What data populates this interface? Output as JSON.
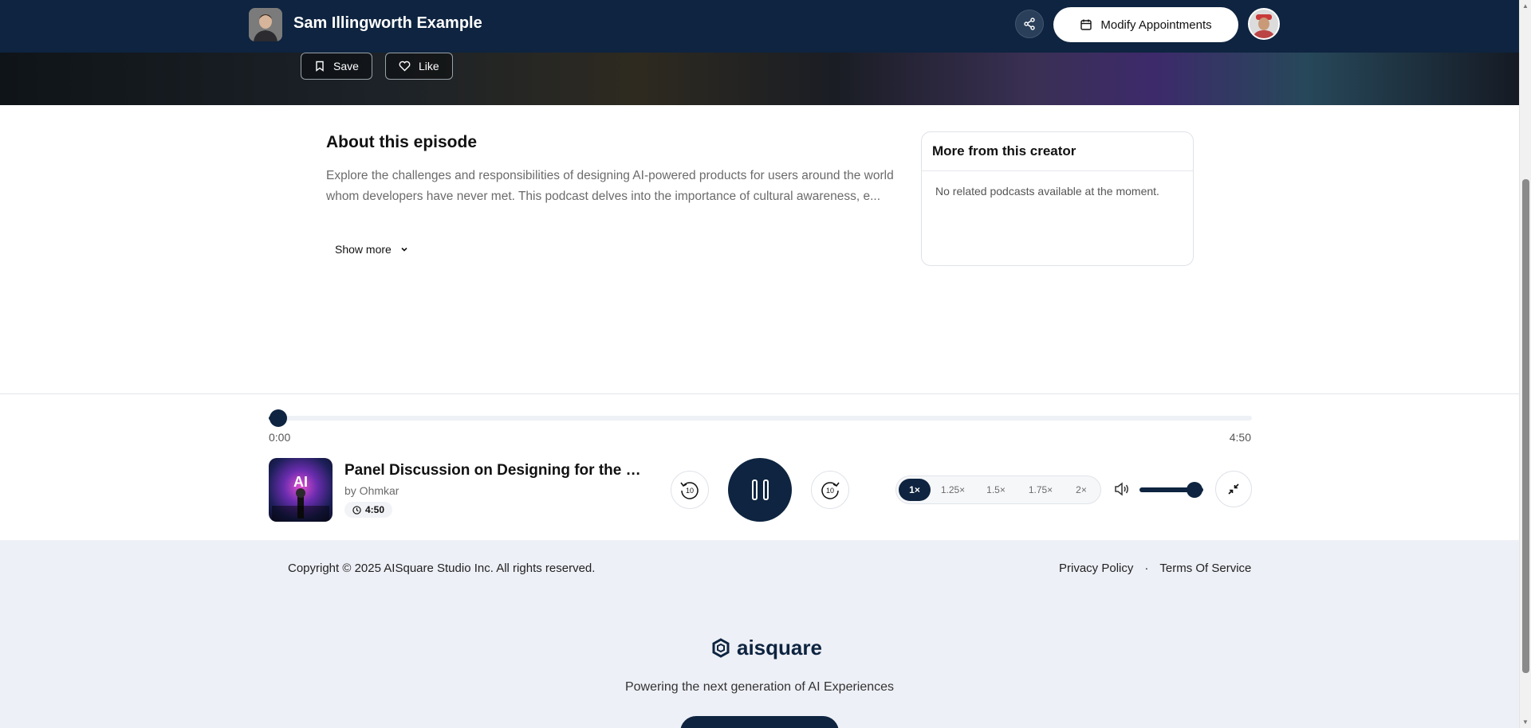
{
  "header": {
    "creator_name": "Sam Illingworth Example",
    "modify_label": "Modify Appointments"
  },
  "hero": {
    "save_label": "Save",
    "like_label": "Like"
  },
  "about": {
    "title": "About this episode",
    "text": "Explore the challenges and responsibilities of designing AI-powered products for users around the world whom developers have never met. This podcast delves into the importance of cultural awareness, e...",
    "show_more": "Show more"
  },
  "creator_panel": {
    "title": "More from this creator",
    "empty_text": "No related podcasts available at the moment."
  },
  "player": {
    "progress_fraction": 0.01,
    "current_time": "0:00",
    "total_time": "4:50",
    "cover_text": "AI",
    "episode_title": "Panel Discussion on Designing for the Unknown User",
    "author": "by Ohmkar",
    "duration": "4:50",
    "skip_back": "10",
    "skip_forward": "10",
    "speeds": [
      "1×",
      "1.25×",
      "1.5×",
      "1.75×",
      "2×"
    ],
    "active_speed": "1×",
    "volume_fraction": 1.0
  },
  "footer": {
    "copyright": "Copyright © 2025 AISquare Studio Inc. All rights reserved.",
    "privacy": "Privacy Policy",
    "separator": "·",
    "terms": "Terms Of Service",
    "logo_text": "aisquare",
    "tagline": "Powering the next generation of AI Experiences"
  },
  "colors": {
    "navy": "#0e2440",
    "page_bg": "#eef0f7"
  }
}
